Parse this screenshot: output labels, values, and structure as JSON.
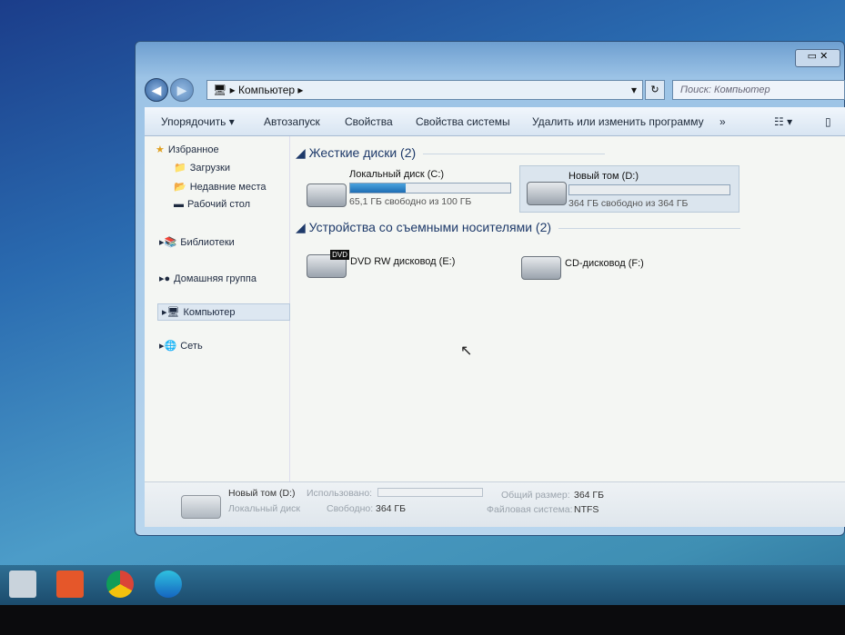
{
  "window": {
    "controls": "▭ ✕",
    "back": "◀",
    "forward": "▶",
    "address": {
      "path": "Компьютер",
      "sep": "▸",
      "dropdown": "▾",
      "refresh": "↻"
    },
    "search_placeholder": "Поиск: Компьютер"
  },
  "toolbar": {
    "organize": "Упорядочить ▾",
    "autoplay": "Автозапуск",
    "properties": "Свойства",
    "system_properties": "Свойства системы",
    "uninstall": "Удалить или изменить программу",
    "more": "»",
    "view": "☷ ▾",
    "preview": "▯"
  },
  "sidebar": {
    "favorites": "Избранное",
    "downloads": "Загрузки",
    "recent": "Недавние места",
    "desktop": "Рабочий стол",
    "libraries": "Библиотеки",
    "homegroup": "Домашняя группа",
    "computer": "Компьютер",
    "network": "Сеть"
  },
  "main": {
    "hdd_group": "Жесткие диски (2)",
    "removable_group": "Устройства со съемными носителями (2)",
    "drives": [
      {
        "name": "Локальный диск (C:)",
        "free": "65,1 ГБ свободно из 100 ГБ",
        "used_fraction": 0.349
      },
      {
        "name": "Новый том (D:)",
        "free": "364 ГБ свободно из 364 ГБ",
        "used_fraction": 0.0
      }
    ],
    "removable": [
      {
        "name": "DVD RW дисковод (E:)",
        "badge": "DVD"
      },
      {
        "name": "CD-дисковод (F:)"
      }
    ]
  },
  "details": {
    "name": "Новый том (D:)",
    "type": "Локальный диск",
    "used_label": "Использовано:",
    "free_label": "Свободно:",
    "free": "364 ГБ",
    "total_label": "Общий размер:",
    "total": "364 ГБ",
    "fs_label": "Файловая система:",
    "fs": "NTFS"
  }
}
